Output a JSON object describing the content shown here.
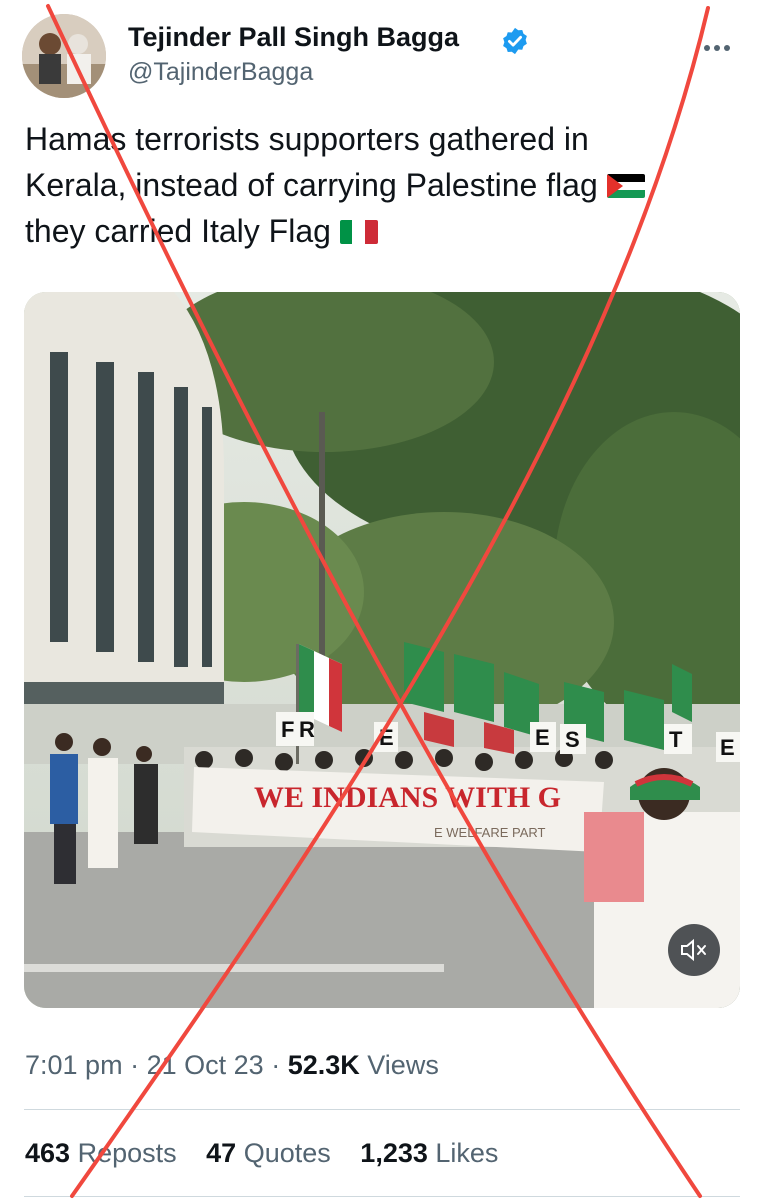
{
  "author": {
    "display_name": "Tejinder Pall Singh Bagga",
    "handle": "@TajinderBagga"
  },
  "tweet": {
    "line1": "Hamas terrorists supporters gathered in",
    "line2": "Kerala, instead of carrying Palestine flag",
    "line3": "they carried Italy Flag",
    "flag_palestine": "palestine-flag-emoji",
    "flag_italy": "italy-flag-emoji"
  },
  "media": {
    "banner_text": "WE INDIANS WITH G",
    "banner_subtext": "E WELFARE PART",
    "placard_letters": [
      "F",
      "R",
      "E",
      "E",
      "S",
      "T",
      "E"
    ]
  },
  "meta": {
    "time": "7:01 pm",
    "separator": "·",
    "date": "21 Oct 23",
    "views_count": "52.3K",
    "views_label": "Views"
  },
  "stats": {
    "reposts_count": "463",
    "reposts_label": "Reposts",
    "quotes_count": "47",
    "quotes_label": "Quotes",
    "likes_count": "1,233",
    "likes_label": "Likes"
  },
  "colors": {
    "verified": "#1d9bf0",
    "secondary_text": "#536471",
    "cross_overlay": "#f0483e"
  }
}
